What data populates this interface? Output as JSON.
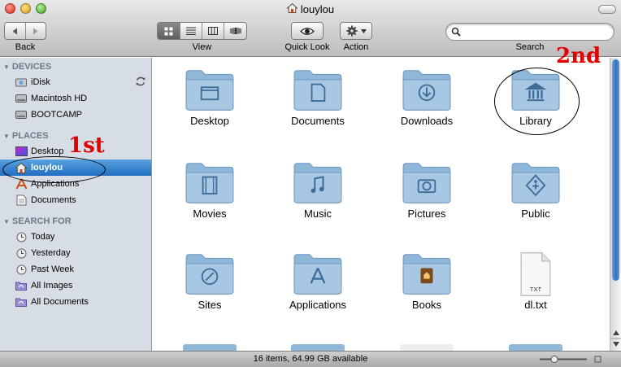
{
  "window": {
    "title": "louylou",
    "title_icon": "home-icon"
  },
  "toolbar": {
    "back_label": "Back",
    "view_label": "View",
    "quicklook_label": "Quick Look",
    "action_label": "Action",
    "search_label": "Search",
    "search_value": "",
    "view_modes": [
      "icon-view",
      "list-view",
      "column-view",
      "coverflow-view"
    ],
    "selected_view": "icon-view"
  },
  "sidebar": {
    "devices_header": "DEVICES",
    "devices": [
      {
        "label": "iDisk",
        "icon": "idisk-icon"
      },
      {
        "label": "Macintosh HD",
        "icon": "harddisk-icon"
      },
      {
        "label": "BOOTCAMP",
        "icon": "harddisk-icon"
      }
    ],
    "places_header": "PLACES",
    "places": [
      {
        "label": "Desktop",
        "icon": "desktop-icon"
      },
      {
        "label": "louylou",
        "icon": "home-icon",
        "selected": true
      },
      {
        "label": "Applications",
        "icon": "applications-icon"
      },
      {
        "label": "Documents",
        "icon": "documents-icon"
      }
    ],
    "search_header": "SEARCH FOR",
    "searches": [
      {
        "label": "Today",
        "icon": "clock-icon"
      },
      {
        "label": "Yesterday",
        "icon": "clock-icon"
      },
      {
        "label": "Past Week",
        "icon": "clock-icon"
      },
      {
        "label": "All Images",
        "icon": "smart-folder-icon"
      },
      {
        "label": "All Documents",
        "icon": "smart-folder-icon"
      }
    ]
  },
  "files": [
    {
      "label": "Desktop",
      "icon": "desktop-folder-icon"
    },
    {
      "label": "Documents",
      "icon": "documents-folder-icon"
    },
    {
      "label": "Downloads",
      "icon": "downloads-folder-icon"
    },
    {
      "label": "Library",
      "icon": "library-folder-icon"
    },
    {
      "label": "Movies",
      "icon": "movies-folder-icon"
    },
    {
      "label": "Music",
      "icon": "music-folder-icon"
    },
    {
      "label": "Pictures",
      "icon": "pictures-folder-icon"
    },
    {
      "label": "Public",
      "icon": "public-folder-icon"
    },
    {
      "label": "Sites",
      "icon": "sites-folder-icon"
    },
    {
      "label": "Applications",
      "icon": "applications-folder-icon"
    },
    {
      "label": "Books",
      "icon": "books-folder-icon"
    },
    {
      "label": "dl.txt",
      "icon": "txt-file-icon",
      "badge": "TXT"
    }
  ],
  "status": {
    "text": "16 items, 64.99 GB available"
  },
  "annotations": {
    "first": "1st",
    "second": "2nd",
    "color": "#e00000"
  },
  "colors": {
    "folder": "#8fb7d9",
    "selection": "#2f7ad0",
    "sidebar": "#d6dde5"
  }
}
